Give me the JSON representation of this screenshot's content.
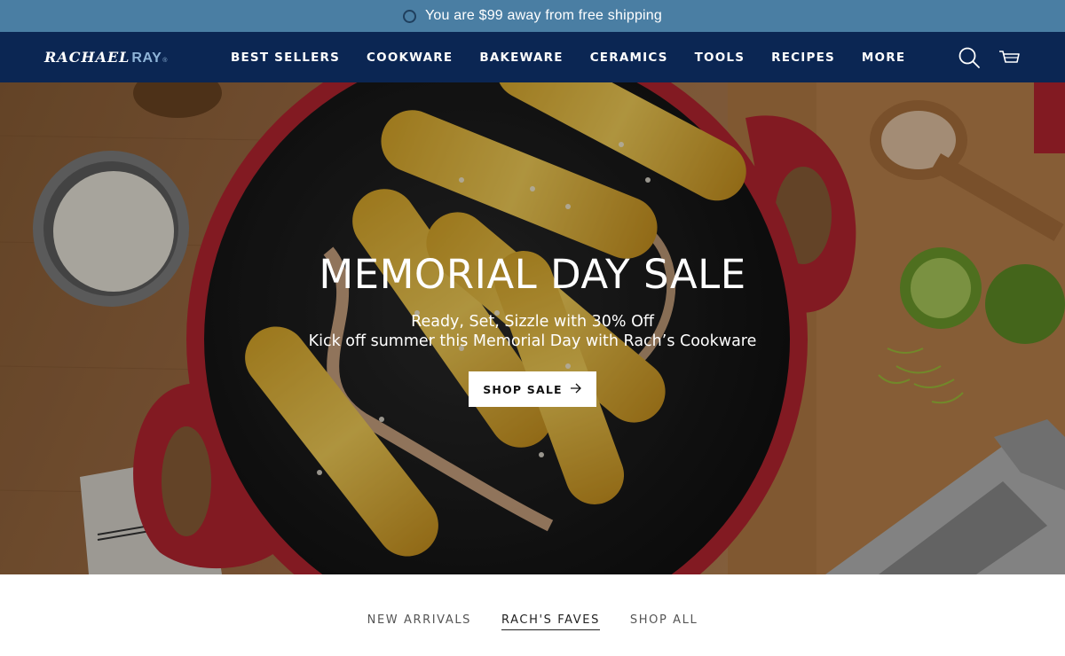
{
  "announcement": {
    "text": "You are $99 away from free shipping"
  },
  "header": {
    "logo_main": "RACHAEL",
    "logo_accent": "RAY",
    "logo_mark": "®",
    "nav": [
      "BEST SELLERS",
      "COOKWARE",
      "BAKEWARE",
      "CERAMICS",
      "TOOLS",
      "RECIPES",
      "MORE"
    ],
    "icons": {
      "search": "search-icon",
      "cart": "cart-icon"
    }
  },
  "hero": {
    "title": "MEMORIAL DAY SALE",
    "subtitle_line1": "Ready, Set, Sizzle with 30% Off",
    "subtitle_line2": "Kick off summer this Memorial Day with Rach’s Cookware",
    "button_label": "SHOP SALE",
    "button_icon": "arrow-right-icon"
  },
  "tabs": {
    "items": [
      "NEW ARRIVALS",
      "RACH'S FAVES",
      "SHOP ALL"
    ],
    "active": "RACH'S FAVES"
  },
  "colors": {
    "announcement_bg": "#4a7ea3",
    "header_bg": "#0b2653",
    "pan_red": "#b52530",
    "button_bg": "#ffffff"
  }
}
